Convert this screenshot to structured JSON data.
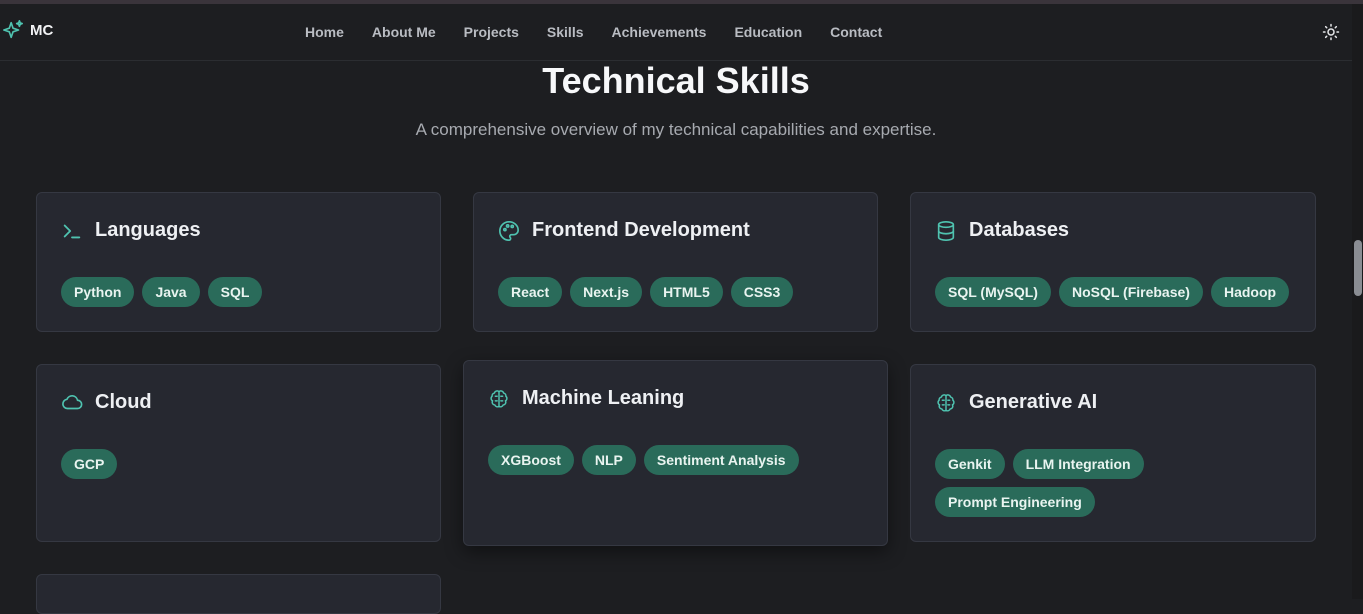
{
  "brand": {
    "label": "MC",
    "icon": "sparkles-icon"
  },
  "nav": {
    "items": [
      "Home",
      "About Me",
      "Projects",
      "Skills",
      "Achievements",
      "Education",
      "Contact"
    ],
    "theme_icon": "sun-icon"
  },
  "section": {
    "title": "Technical Skills",
    "subtitle": "A comprehensive overview of my technical capabilities and expertise."
  },
  "cards": [
    {
      "title": "Languages",
      "icon": "terminal-icon",
      "skills": [
        "Python",
        "Java",
        "SQL"
      ]
    },
    {
      "title": "Frontend Development",
      "icon": "palette-icon",
      "skills": [
        "React",
        "Next.js",
        "HTML5",
        "CSS3"
      ]
    },
    {
      "title": "Databases",
      "icon": "database-icon",
      "skills": [
        "SQL (MySQL)",
        "NoSQL (Firebase)",
        "Hadoop"
      ]
    },
    {
      "title": "Cloud",
      "icon": "cloud-icon",
      "skills": [
        "GCP"
      ]
    },
    {
      "title": "Machine Leaning",
      "icon": "brain-icon",
      "skills": [
        "XGBoost",
        "NLP",
        "Sentiment Analysis"
      ]
    },
    {
      "title": "Generative AI",
      "icon": "brain-icon",
      "skills": [
        "Genkit",
        "LLM Integration",
        "Prompt Engineering"
      ]
    }
  ],
  "colors": {
    "accent": "#4fc3b0",
    "chip_bg": "#2a6b5a",
    "background": "#1d1e21",
    "card_bg": "#262830"
  }
}
